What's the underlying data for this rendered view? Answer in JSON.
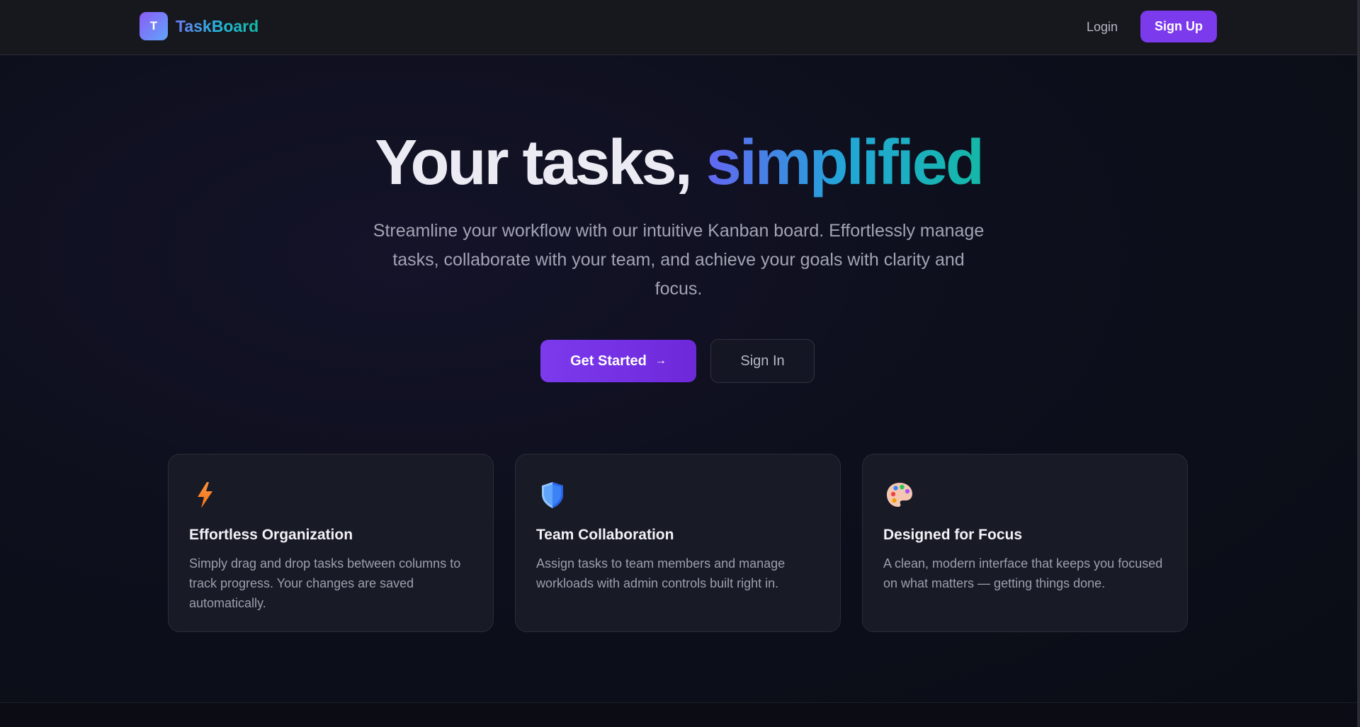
{
  "brand": {
    "logo_letter": "T",
    "name": "TaskBoard"
  },
  "nav": {
    "login_label": "Login",
    "signup_label": "Sign Up"
  },
  "hero": {
    "title_main": "Your tasks, ",
    "title_accent": "simplified",
    "subtitle": "Streamline your workflow with our intuitive Kanban board. Effortlessly manage tasks, collaborate with your team, and achieve your goals with clarity and focus.",
    "primary_button": "Get Started",
    "primary_button_icon": "→",
    "secondary_button": "Sign In"
  },
  "features": [
    {
      "icon": "lightning-icon",
      "title": "Effortless Organization",
      "description": "Simply drag and drop tasks between columns to track progress. Your changes are saved automatically."
    },
    {
      "icon": "shield-icon",
      "title": "Team Collaboration",
      "description": "Assign tasks to team members and manage workloads with admin controls built right in."
    },
    {
      "icon": "palette-icon",
      "title": "Designed for Focus",
      "description": "A clean, modern interface that keeps you focused on what matters — getting things done."
    }
  ],
  "colors": {
    "accent": "#7c3aed",
    "background": "#0b0d17",
    "card": "#181a26"
  }
}
